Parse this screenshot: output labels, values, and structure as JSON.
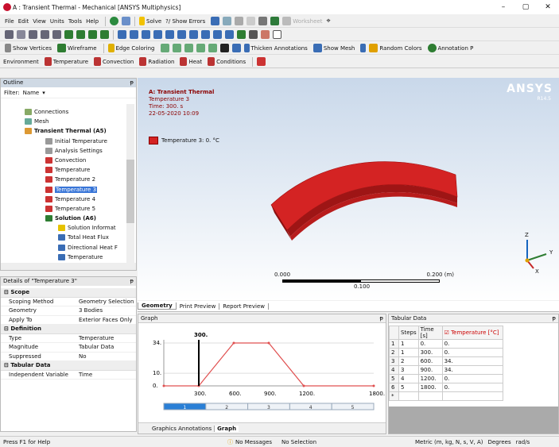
{
  "window": {
    "title": "A : Transient Thermal - Mechanical [ANSYS Multiphysics]",
    "minimize": "–",
    "maximize": "▢",
    "close": "✕"
  },
  "menu": [
    "File",
    "Edit",
    "View",
    "Units",
    "Tools",
    "Help"
  ],
  "toolbar1": {
    "solve": "Solve",
    "show_errors": "?/ Show Errors",
    "worksheet": "Worksheet"
  },
  "toolbar3": {
    "show_vertices": "Show Vertices",
    "wireframe": "Wireframe",
    "edge_coloring": "Edge Coloring",
    "thicken": "Thicken Annotations",
    "show_mesh": "Show Mesh",
    "random_colors": "Random Colors",
    "annotation": "Annotation P"
  },
  "toolbar4": {
    "environment": "Environment",
    "temperature": "Temperature",
    "convection": "Convection",
    "radiation": "Radiation",
    "heat": "Heat",
    "conditions": "Conditions"
  },
  "outline": {
    "title": "Outline",
    "pin": "ᵽ",
    "filter": "Filter:",
    "filter_value": "Name",
    "items": [
      "Connections",
      "Mesh",
      "Transient Thermal (A5)",
      "Initial Temperature",
      "Analysis Settings",
      "Convection",
      "Temperature",
      "Temperature 2",
      "Temperature 3",
      "Temperature 4",
      "Temperature 5",
      "Solution (A6)",
      "Solution Informat",
      "Total Heat Flux",
      "Directional Heat F",
      "Temperature"
    ]
  },
  "details": {
    "title": "Details of \"Temperature 3\"",
    "pin": "ᵽ",
    "scope": "Scope",
    "scoping_method": [
      "Scoping Method",
      "Geometry Selection"
    ],
    "geometry": [
      "Geometry",
      "3 Bodies"
    ],
    "apply_to": [
      "Apply To",
      "Exterior Faces Only"
    ],
    "definition": "Definition",
    "type": [
      "Type",
      "Temperature"
    ],
    "magnitude": [
      "Magnitude",
      "Tabular Data"
    ],
    "suppressed": [
      "Suppressed",
      "No"
    ],
    "tabular": "Tabular Data",
    "indep": [
      "Independent Variable",
      "Time"
    ]
  },
  "viewport": {
    "analysis": "A: Transient Thermal",
    "object": "Temperature 3",
    "time": "Time: 300. s",
    "date": "22-05-2020 10:09",
    "legend": "Temperature 3: 0. °C",
    "brand": "ANSYS",
    "version": "R14.5",
    "scale_left": "0.000",
    "scale_mid": "0.100",
    "scale_right": "0.200 (m)",
    "axis_z": "Z",
    "axis_y": "Y",
    "axis_x": "X",
    "body_color": "#c41e1e"
  },
  "tabs": [
    "Geometry",
    "Print Preview",
    "Report Preview"
  ],
  "graph": {
    "title": "Graph",
    "pin": "ᵽ",
    "marker": "300.",
    "yticks": [
      "34.",
      "10.",
      "0."
    ],
    "xticks": [
      "300.",
      "600.",
      "900.",
      "1200.",
      "1800."
    ],
    "steps": [
      "1",
      "2",
      "3",
      "4",
      "5"
    ],
    "bottom_tabs": [
      "Graphics Annotations",
      "Graph"
    ]
  },
  "chart_data": {
    "type": "line",
    "x": [
      0,
      300,
      600,
      900,
      1200,
      1800
    ],
    "values": [
      0,
      0,
      34,
      34,
      0,
      0
    ],
    "ylim": [
      0,
      34
    ],
    "xlim": [
      0,
      1800
    ],
    "cursor_x": 300
  },
  "tabular": {
    "title": "Tabular Data",
    "pin": "ᵽ",
    "headers": [
      "Steps",
      "Time [s]",
      "Temperature [°C]"
    ],
    "rows": [
      [
        "1",
        "1",
        "0.",
        "0."
      ],
      [
        "2",
        "1",
        "300.",
        "0."
      ],
      [
        "3",
        "2",
        "600.",
        "34."
      ],
      [
        "4",
        "3",
        "900.",
        "34."
      ],
      [
        "5",
        "4",
        "1200.",
        "0."
      ],
      [
        "6",
        "5",
        "1800.",
        "0."
      ],
      [
        "*",
        "",
        "",
        ""
      ]
    ]
  },
  "status": {
    "help": "Press F1 for Help",
    "messages": "No Messages",
    "selection": "No Selection",
    "units": "Metric (m, kg, N, s, V, A)",
    "degrees": "Degrees",
    "rads": "rad/s"
  }
}
